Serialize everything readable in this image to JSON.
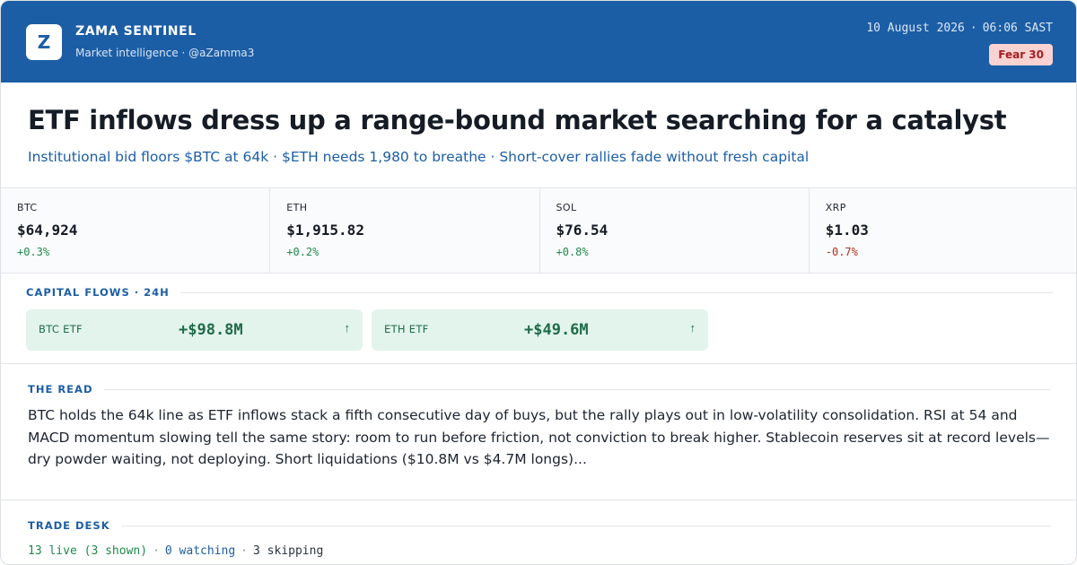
{
  "header": {
    "logo_letter": "Z",
    "brand_name": "ZAMA SENTINEL",
    "tagline": "Market intelligence · @aZamma3",
    "date": "10 August 2026",
    "separator": "·",
    "time": "06:06 SAST",
    "sentiment_badge": "Fear 30"
  },
  "headline": "ETF inflows dress up a range-bound market searching for a catalyst",
  "subheadline": "Institutional bid floors $BTC at 64k · $ETH needs 1,980 to breathe · Short-cover rallies fade without fresh capital",
  "tickers": [
    {
      "symbol": "BTC",
      "price": "$64,924",
      "change": "+0.3%",
      "direction": "up"
    },
    {
      "symbol": "ETH",
      "price": "$1,915.82",
      "change": "+0.2%",
      "direction": "up"
    },
    {
      "symbol": "SOL",
      "price": "$76.54",
      "change": "+0.8%",
      "direction": "up"
    },
    {
      "symbol": "XRP",
      "price": "$1.03",
      "change": "-0.7%",
      "direction": "down"
    }
  ],
  "capital_flows": {
    "title": "CAPITAL FLOWS · 24H",
    "items": [
      {
        "name": "BTC ETF",
        "amount": "+$98.8M",
        "arrow": "↑"
      },
      {
        "name": "ETH ETF",
        "amount": "+$49.6M",
        "arrow": "↑"
      }
    ]
  },
  "the_read": {
    "title": "THE READ",
    "body": "BTC holds the 64k line as ETF inflows stack a fifth consecutive day of buys, but the rally plays out in low-volatility consolidation. RSI at 54 and MACD momentum slowing tell the same story: room to run before friction, not conviction to break higher. Stablecoin reserves sit at record levels—dry powder waiting, not deploying. Short liquidations ($10.8M vs $4.7M longs)..."
  },
  "trade_desk": {
    "title": "TRADE DESK",
    "live": "13 live (3 shown)",
    "watching": "0 watching",
    "skipping": "3 skipping",
    "separator": "·"
  },
  "colors": {
    "brand_blue": "#1c5ea6",
    "positive": "#1f8a4c",
    "negative": "#b0301e",
    "fear_bg": "#fbd2d2",
    "fear_text": "#a32020",
    "flow_bg": "#e2f4ec"
  }
}
